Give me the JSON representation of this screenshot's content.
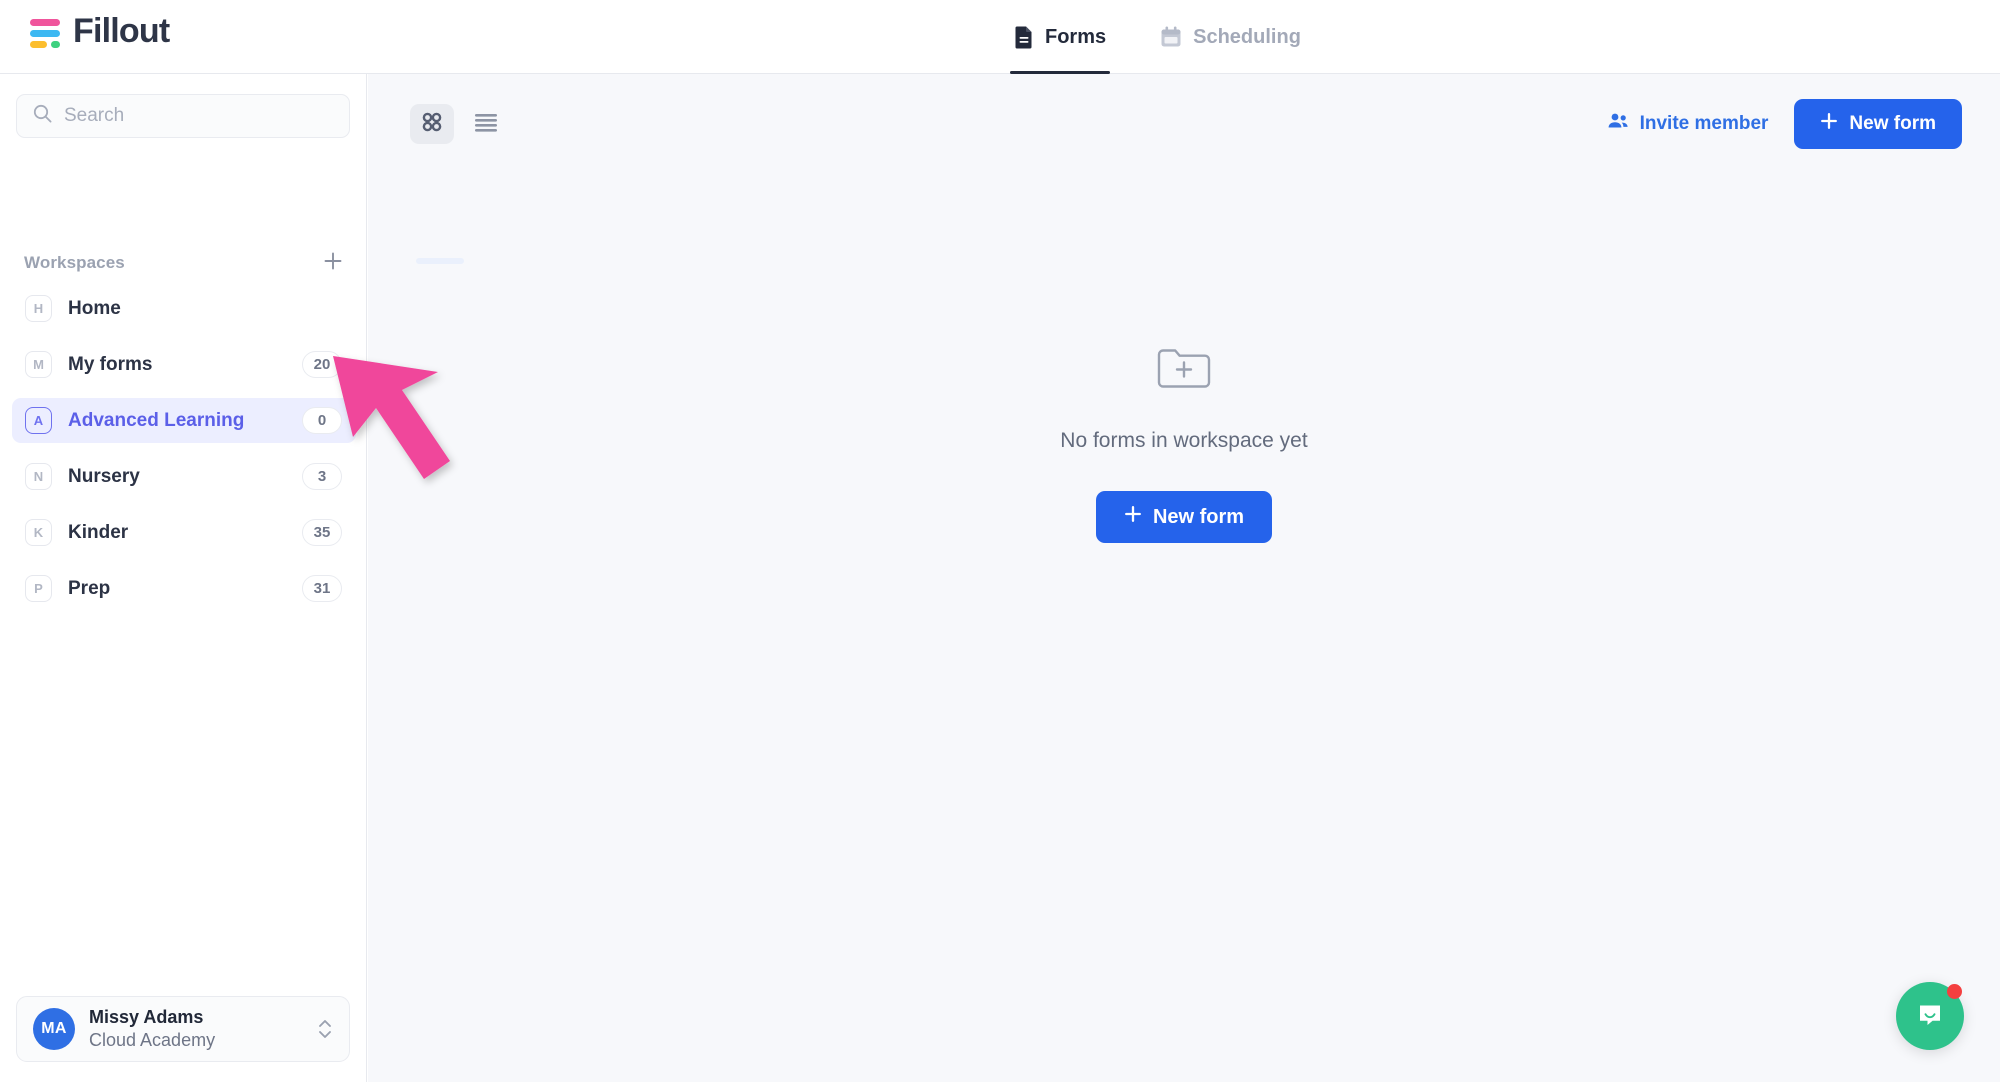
{
  "header": {
    "brand_name": "Fillout",
    "logo_icon": "fillout-logo-icon",
    "tabs": [
      {
        "label": "Forms",
        "icon": "document-icon",
        "active": true
      },
      {
        "label": "Scheduling",
        "icon": "calendar-icon",
        "active": false
      }
    ]
  },
  "sidebar": {
    "search": {
      "placeholder": "Search",
      "value": "",
      "icon": "search-icon"
    },
    "workspaces_label": "Workspaces",
    "add_workspace_icon": "plus-icon",
    "items": [
      {
        "initial": "H",
        "label": "Home",
        "count": "",
        "active": false
      },
      {
        "initial": "M",
        "label": "My forms",
        "count": "20",
        "active": false
      },
      {
        "initial": "A",
        "label": "Advanced Learning",
        "count": "0",
        "active": true
      },
      {
        "initial": "N",
        "label": "Nursery",
        "count": "3",
        "active": false
      },
      {
        "initial": "K",
        "label": "Kinder",
        "count": "35",
        "active": false
      },
      {
        "initial": "P",
        "label": "Prep",
        "count": "31",
        "active": false
      }
    ],
    "user": {
      "initials": "MA",
      "name": "Missy Adams",
      "organization": "Cloud Academy",
      "chevron_icon": "chevron-up-down-icon"
    }
  },
  "main": {
    "view_toggle": {
      "grid_icon": "grid-view-icon",
      "list_icon": "list-view-icon",
      "active": "grid"
    },
    "invite_member_label": "Invite member",
    "invite_member_icon": "users-icon",
    "new_form_label": "New form",
    "new_form_icon": "plus-icon",
    "empty_state": {
      "icon": "folder-plus-icon",
      "message": "No forms in workspace yet",
      "button_label": "New form",
      "button_icon": "plus-icon"
    }
  },
  "chat_widget": {
    "icon": "chat-bubble-icon",
    "has_notification": true
  },
  "annotation": {
    "type": "arrow",
    "color": "#f0469b",
    "points_to": "sidebar-item-advanced-learning"
  },
  "colors": {
    "accent_blue": "#2563eb",
    "active_indigo": "#5b5fe8",
    "active_bg": "#eceeff",
    "chat_green": "#2ec28b",
    "annotation_pink": "#f0469b"
  }
}
